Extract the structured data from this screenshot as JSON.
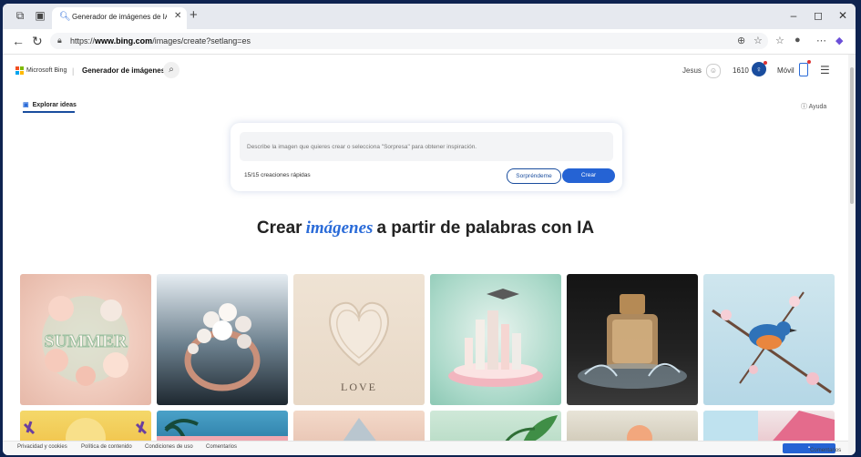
{
  "browser": {
    "tab_title": "Generador de imágenes de IA gra",
    "url_prefix": "https://",
    "url_domain": "www.bing.com",
    "url_path": "/images/create?setlang=es"
  },
  "header": {
    "brand": "Microsoft Bing",
    "product": "Generador de imágenes",
    "user": "Jesus",
    "coins": "1610",
    "mobile": "Móvil"
  },
  "nav": {
    "explore": "Explorar ideas",
    "help": "Ayuda"
  },
  "prompt": {
    "placeholder": "Describe la imagen que quieres crear o selecciona \"Sorpresa\" para obtener inspiración.",
    "quick": "15/15 creaciones rápidas",
    "surprise": "Sorpréndeme",
    "create": "Crear"
  },
  "headline": {
    "pre": "Crear",
    "emph": "imágenes",
    "post": "a partir de palabras con IA"
  },
  "gallery": {
    "row1": [
      "summer",
      "ring",
      "love",
      "city",
      "perfume",
      "bird"
    ],
    "love_text": "LOVE",
    "summer_text": "SUMMER"
  },
  "footer": {
    "privacy": "Privacidad y cookies",
    "content": "Política de contenido",
    "terms": "Condiciones de uso",
    "comments": "Comentarios",
    "feedback": "Comentarios"
  }
}
